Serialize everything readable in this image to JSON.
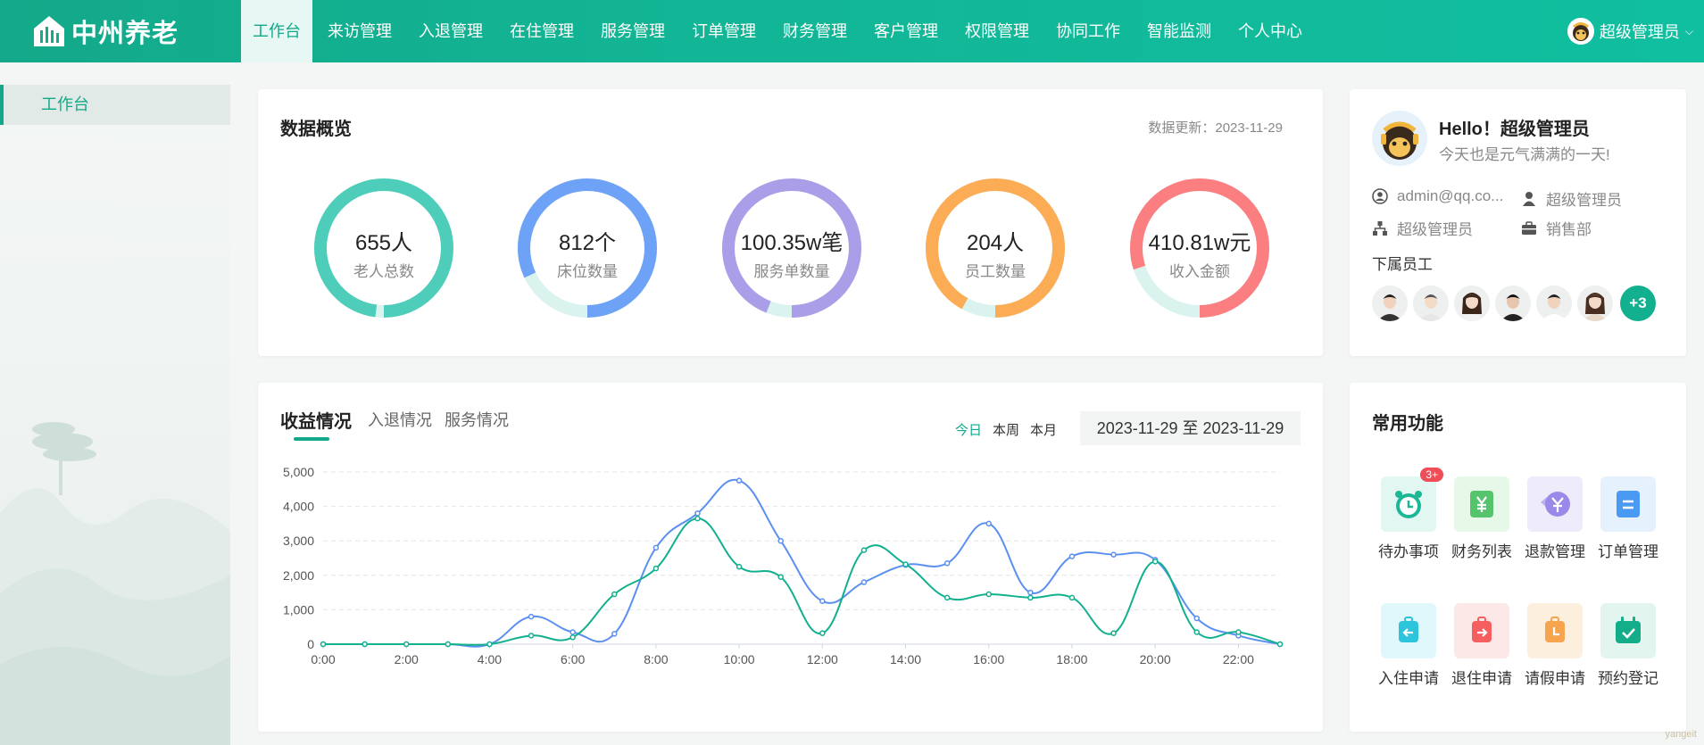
{
  "brand": {
    "name": "中州养老"
  },
  "nav": {
    "items": [
      "工作台",
      "来访管理",
      "入退管理",
      "在住管理",
      "服务管理",
      "订单管理",
      "财务管理",
      "客户管理",
      "权限管理",
      "协同工作",
      "智能监测",
      "个人中心"
    ],
    "active": "工作台"
  },
  "user": {
    "name": "超级管理员"
  },
  "sidebar": {
    "items": [
      "工作台"
    ]
  },
  "overview": {
    "title": "数据概览",
    "update_label": "数据更新：",
    "update_date": "2023-11-29",
    "stats": [
      {
        "value": "655人",
        "label": "老人总数",
        "color": "#4ecdba",
        "fraction": 0.98
      },
      {
        "value": "812个",
        "label": "床位数量",
        "color": "#6ea2f6",
        "fraction": 0.82
      },
      {
        "value": "100.35w笔",
        "label": "服务单数量",
        "color": "#ab9ee8",
        "fraction": 0.94
      },
      {
        "value": "204人",
        "label": "员工数量",
        "color": "#fbac55",
        "fraction": 0.92
      },
      {
        "value": "410.81w元",
        "label": "收入金额",
        "color": "#fb7f81",
        "fraction": 0.8
      }
    ],
    "track_color": "#dbf3ee"
  },
  "profile": {
    "hello": "Hello！超级管理员",
    "subtitle": "今天也是元气满满的一天!",
    "email": "admin@qq.co...",
    "role": "超级管理员",
    "org": "超级管理员",
    "dept": "销售部",
    "staff_title": "下属员工",
    "staff_more": "+3"
  },
  "revenue": {
    "tabs": [
      "收益情况",
      "入退情况",
      "服务情况"
    ],
    "ranges": [
      "今日",
      "本周",
      "本月"
    ],
    "date_range": "2023-11-29 至 2023-11-29"
  },
  "chart_data": {
    "type": "line",
    "x": [
      "0:00",
      "1:00",
      "2:00",
      "3:00",
      "4:00",
      "5:00",
      "6:00",
      "7:00",
      "8:00",
      "9:00",
      "10:00",
      "11:00",
      "12:00",
      "13:00",
      "14:00",
      "15:00",
      "16:00",
      "17:00",
      "18:00",
      "19:00",
      "20:00",
      "21:00",
      "22:00",
      "23:00"
    ],
    "tick_labels": [
      "0:00",
      "2:00",
      "4:00",
      "6:00",
      "8:00",
      "10:00",
      "12:00",
      "14:00",
      "16:00",
      "18:00",
      "20:00",
      "22:00"
    ],
    "series": [
      {
        "color": "#5b8ff0",
        "values": [
          0,
          0,
          0,
          0,
          0,
          800,
          350,
          300,
          2800,
          3800,
          4750,
          3000,
          1250,
          1800,
          2300,
          2350,
          3500,
          1500,
          2550,
          2600,
          2450,
          750,
          250,
          0
        ]
      },
      {
        "color": "#12b08f",
        "values": [
          0,
          0,
          0,
          0,
          0,
          250,
          200,
          1450,
          2200,
          3650,
          2250,
          1950,
          320,
          2730,
          2320,
          1350,
          1450,
          1350,
          1350,
          320,
          2400,
          350,
          350,
          0
        ]
      }
    ],
    "yticks": [
      0,
      1000,
      2000,
      3000,
      4000,
      5000
    ],
    "ytick_labels": [
      "0",
      "1,000",
      "2,000",
      "3,000",
      "4,000",
      "5,000"
    ],
    "ylim": [
      0,
      5000
    ],
    "grid": true
  },
  "functions": {
    "title": "常用功能",
    "items": [
      {
        "label": "待办事项",
        "icon": "clock-icon",
        "bg": "#e3f7f2",
        "fg": "#1cb896",
        "badge": "3+"
      },
      {
        "label": "财务列表",
        "icon": "yuan-icon",
        "bg": "#e6f8e8",
        "fg": "#55c46c"
      },
      {
        "label": "退款管理",
        "icon": "refund-icon",
        "bg": "#eeebfb",
        "fg": "#9b89ea"
      },
      {
        "label": "订单管理",
        "icon": "order-icon",
        "bg": "#e5f1fd",
        "fg": "#4a9af3"
      },
      {
        "label": "入住申请",
        "icon": "checkin-icon",
        "bg": "#e0f8fb",
        "fg": "#2cc5dc"
      },
      {
        "label": "退住申请",
        "icon": "checkout-icon",
        "bg": "#fde8e8",
        "fg": "#f55f5f"
      },
      {
        "label": "请假申请",
        "icon": "leave-icon",
        "bg": "#fdefde",
        "fg": "#f6a44d"
      },
      {
        "label": "预约登记",
        "icon": "calendar-icon",
        "bg": "#e2f6ef",
        "fg": "#13ad89"
      }
    ]
  },
  "watermark": "yangeit"
}
